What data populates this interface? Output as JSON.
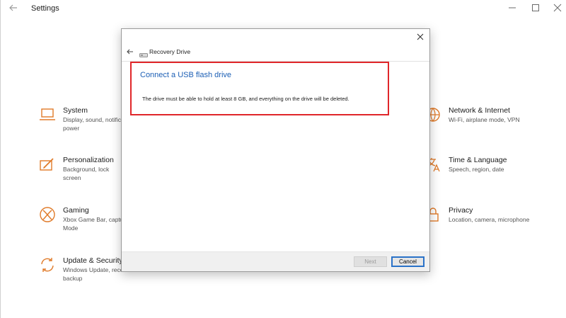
{
  "settings": {
    "title": "Settings",
    "accent_color": "#e07a28",
    "tiles": [
      {
        "id": "system",
        "title": "System",
        "desc": "Display, sound, notifica power"
      },
      {
        "id": "personalization",
        "title": "Personalization",
        "desc": "Background, lock screen"
      },
      {
        "id": "gaming",
        "title": "Gaming",
        "desc": "Xbox Game Bar, captur Mode"
      },
      {
        "id": "update",
        "title": "Update & Security",
        "desc": "Windows Update, recov backup"
      },
      {
        "id": "network",
        "title": "Network & Internet",
        "desc": "Wi-Fi, airplane mode, VPN"
      },
      {
        "id": "time",
        "title": "Time & Language",
        "desc": "Speech, region, date"
      },
      {
        "id": "privacy",
        "title": "Privacy",
        "desc": "Location, camera, microphone"
      }
    ]
  },
  "dialog": {
    "title": "Recovery Drive",
    "heading": "Connect a USB flash drive",
    "body": "The drive must be able to hold at least 8 GB, and everything on the drive will be deleted.",
    "next_label": "Next",
    "cancel_label": "Cancel",
    "heading_color": "#1c5fb5",
    "highlight_color": "#e0262a"
  }
}
